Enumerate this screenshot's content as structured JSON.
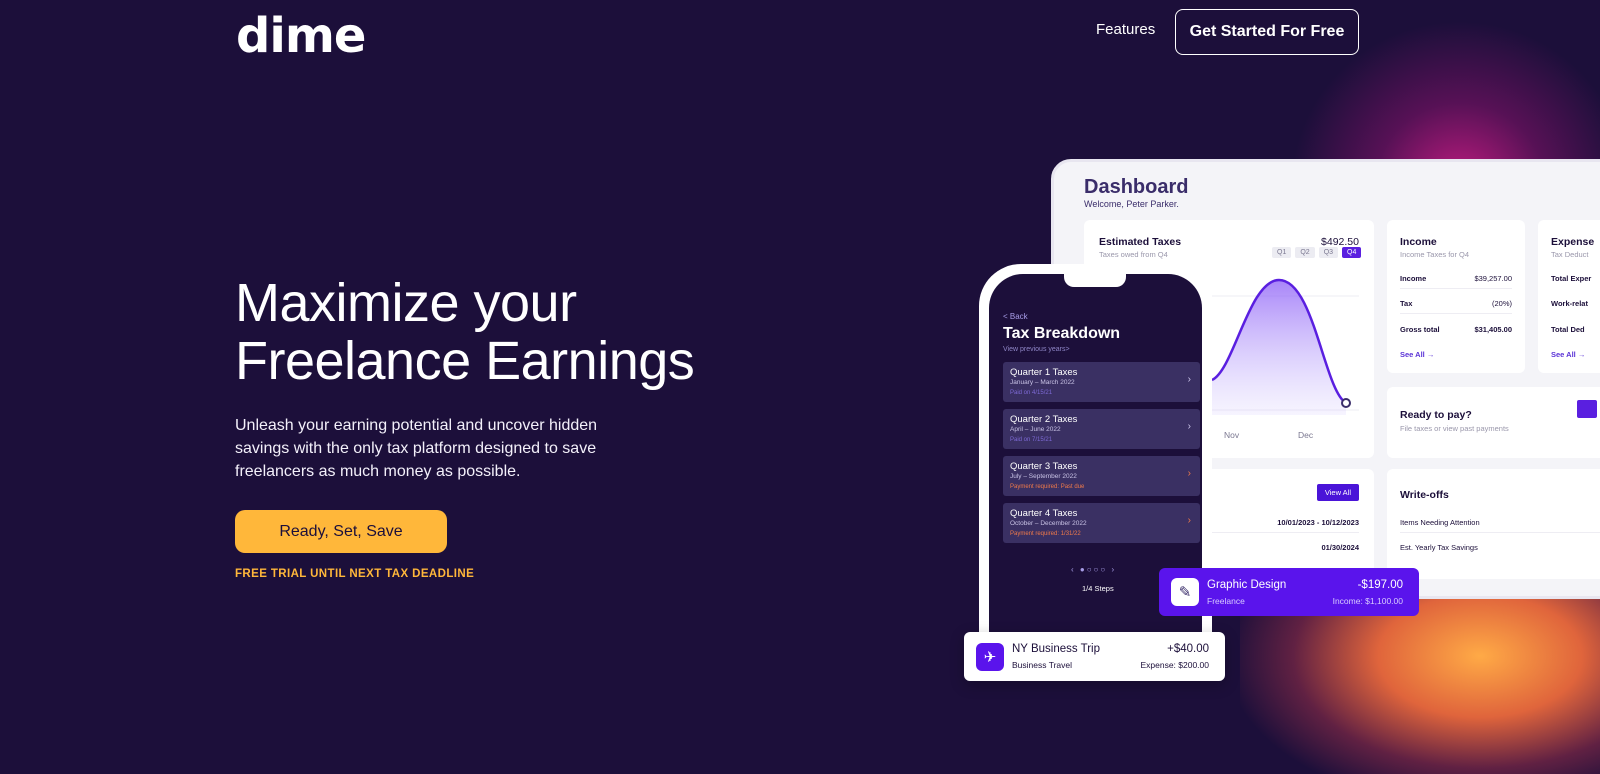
{
  "header": {
    "logo": "dime",
    "nav_features": "Features",
    "cta": "Get Started For Free"
  },
  "hero": {
    "title_line1": "Maximize your",
    "title_line2": "Freelance Earnings",
    "subtitle": "Unleash your earning potential and uncover hidden savings with the only tax platform designed to save freelancers as much money as possible.",
    "button": "Ready, Set, Save",
    "note": "FREE TRIAL UNTIL NEXT TAX DEADLINE"
  },
  "dashboard": {
    "title": "Dashboard",
    "welcome": "Welcome, Peter Parker.",
    "estimated": {
      "label": "Estimated Taxes",
      "sub": "Taxes owed from Q4",
      "amount": "$492.50",
      "quarters": [
        "Q1",
        "Q2",
        "Q3",
        "Q4"
      ],
      "active_quarter": "Q4",
      "x_labels": [
        "Nov",
        "Dec"
      ]
    },
    "income": {
      "label": "Income",
      "sub": "Income Taxes for Q4",
      "rows": [
        {
          "k": "Income",
          "v": "$39,257.00"
        },
        {
          "k": "Tax",
          "v": "(20%)"
        },
        {
          "k": "Gross total",
          "v": "$31,405.00"
        }
      ],
      "see_all": "See All →"
    },
    "expenses": {
      "label": "Expense",
      "sub": "Tax Deduct",
      "rows": [
        "Total Exper",
        "Work-relat",
        "Total Ded"
      ],
      "see_all": "See All →"
    },
    "ready": {
      "label": "Ready to pay?",
      "sub": "File taxes or view past payments"
    },
    "dates": {
      "view_all": "View All",
      "range": "10/01/2023 - 10/12/2023",
      "due": "01/30/2024"
    },
    "writeoffs": {
      "label": "Write-offs",
      "rows": [
        "Items Needing Attention",
        "Est. Yearly Tax Savings"
      ]
    }
  },
  "phone": {
    "back": "< Back",
    "title": "Tax Breakdown",
    "sub": "View previous years>",
    "quarters": [
      {
        "title": "Quarter 1 Taxes",
        "dates": "January – March 2022",
        "status": "Paid on 4/15/21",
        "due": false
      },
      {
        "title": "Quarter 2 Taxes",
        "dates": "April – June 2022",
        "status": "Paid on 7/15/21",
        "due": false
      },
      {
        "title": "Quarter 3 Taxes",
        "dates": "July – September 2022",
        "status": "Payment required: Past due",
        "due": true
      },
      {
        "title": "Quarter 4 Taxes",
        "dates": "October – December 2022",
        "status": "Payment required: 1/31/22",
        "due": true
      }
    ],
    "steps": "1/4 Steps"
  },
  "transactions": {
    "graphic": {
      "name": "Graphic Design",
      "category": "Freelance",
      "amount": "-$197.00",
      "detail": "Income: $1,100.00"
    },
    "trip": {
      "name": "NY Business Trip",
      "category": "Business Travel",
      "amount": "+$40.00",
      "detail": "Expense: $200.00"
    }
  }
}
